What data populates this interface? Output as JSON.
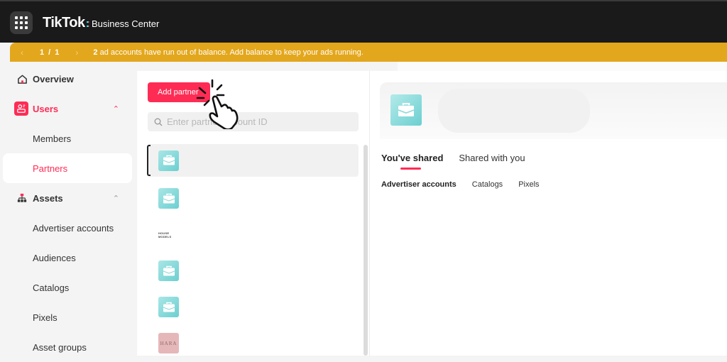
{
  "header": {
    "brand": "TikTok",
    "product": "Business Center",
    "icons": {
      "app_menu": "grid-icon"
    }
  },
  "banner": {
    "pager": "1 / 1",
    "count": "2",
    "message": " ad accounts have run out of balance. Add balance to keep your ads running.",
    "color": "#e3a71d",
    "icons": {
      "prev": "chevron-left-icon",
      "next": "chevron-right-icon"
    }
  },
  "sidebar": {
    "items": [
      {
        "label": "Overview",
        "icon": "home-icon",
        "type": "top"
      },
      {
        "label": "Users",
        "icon": "users-icon",
        "type": "group",
        "expanded": true
      },
      {
        "label": "Members",
        "type": "sub"
      },
      {
        "label": "Partners",
        "type": "sub",
        "selected": true
      },
      {
        "label": "Assets",
        "icon": "sitemap-icon",
        "type": "group",
        "expanded": true
      },
      {
        "label": "Advertiser accounts",
        "type": "sub"
      },
      {
        "label": "Audiences",
        "type": "sub"
      },
      {
        "label": "Catalogs",
        "type": "sub"
      },
      {
        "label": "Pixels",
        "type": "sub"
      },
      {
        "label": "Asset groups",
        "type": "sub"
      }
    ]
  },
  "partners": {
    "add_button": "Add partner",
    "search_placeholder": "Enter partner account ID",
    "list": [
      {
        "avatar": "briefcase-icon",
        "selected": true
      },
      {
        "avatar": "briefcase-icon"
      },
      {
        "avatar": "text-logo",
        "logo_text": "HOUSE MODELS"
      },
      {
        "avatar": "briefcase-icon"
      },
      {
        "avatar": "briefcase-icon"
      },
      {
        "avatar": "pink-logo",
        "logo_text": "HARA"
      }
    ]
  },
  "detail": {
    "tabs": [
      {
        "label": "You've shared",
        "active": true
      },
      {
        "label": "Shared with you"
      }
    ],
    "subtabs": [
      {
        "label": "Advertiser accounts",
        "active": true
      },
      {
        "label": "Catalogs"
      },
      {
        "label": "Pixels"
      }
    ]
  },
  "colors": {
    "accent": "#fe2c55",
    "banner": "#e3a71d",
    "topbar": "#1a1a1a",
    "avatar_teal": "#6ccfd0"
  }
}
